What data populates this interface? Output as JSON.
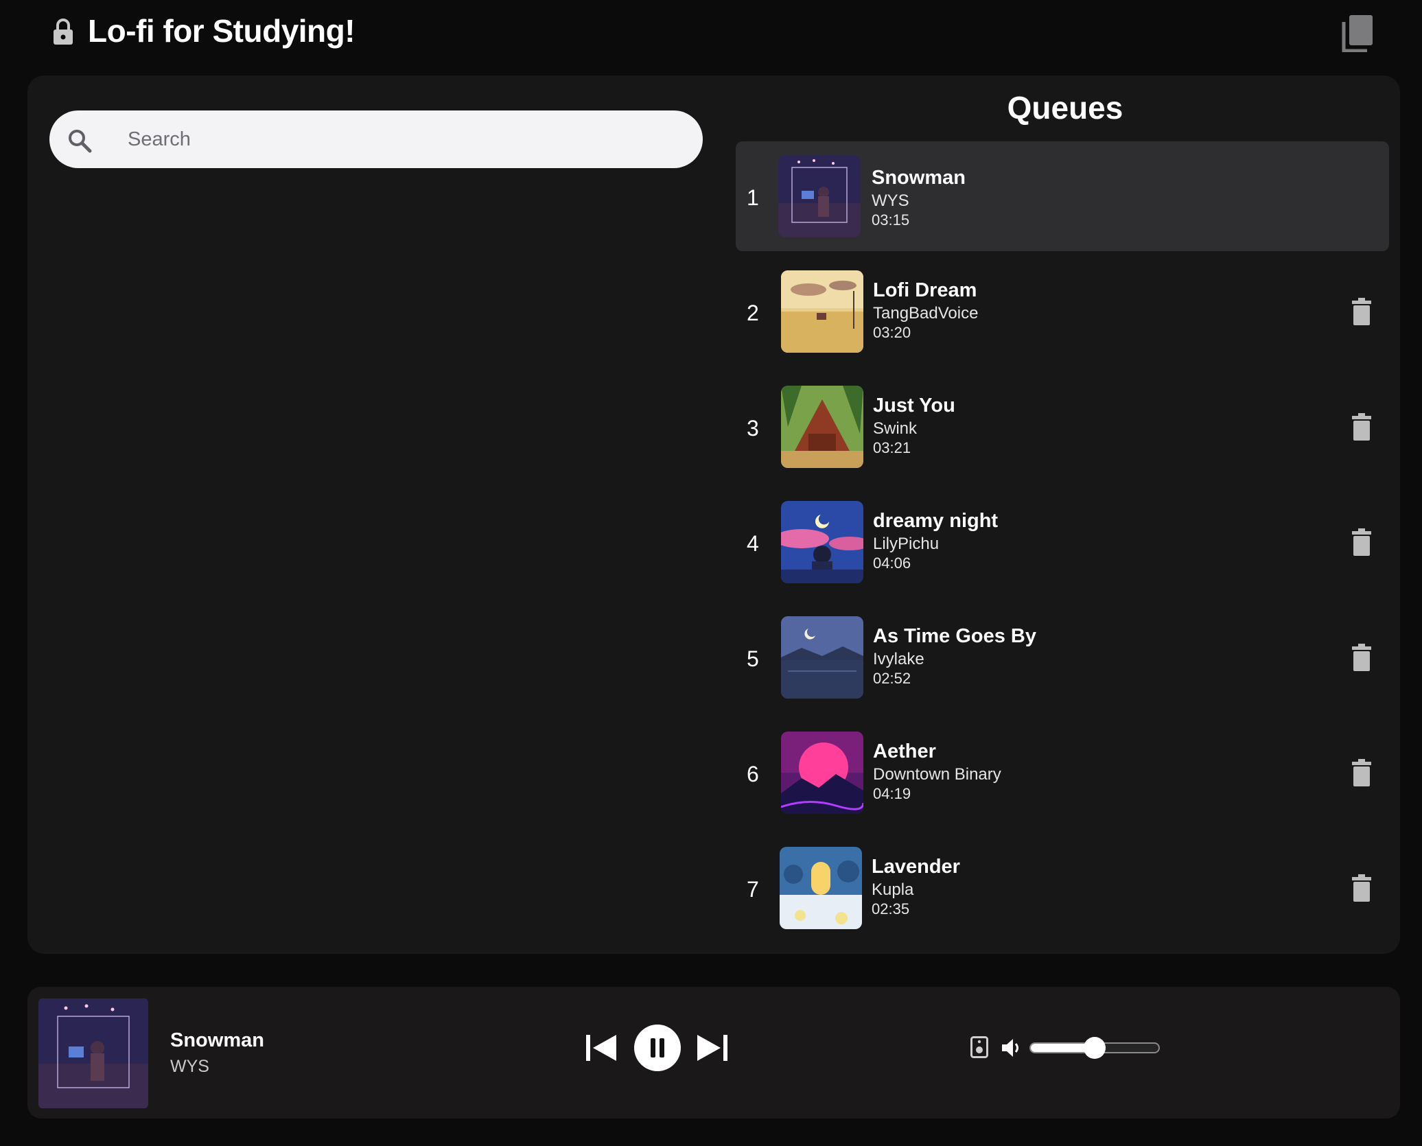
{
  "header": {
    "title": "Lo-fi for Studying!"
  },
  "search": {
    "placeholder": "Search"
  },
  "queue": {
    "heading": "Queues",
    "items": [
      {
        "num": "1",
        "title": "Snowman",
        "artist": "WYS",
        "duration": "03:15",
        "active": true
      },
      {
        "num": "2",
        "title": "Lofi Dream",
        "artist": "TangBadVoice",
        "duration": "03:20",
        "active": false
      },
      {
        "num": "3",
        "title": "Just You",
        "artist": "Swink",
        "duration": "03:21",
        "active": false
      },
      {
        "num": "4",
        "title": "dreamy night",
        "artist": "LilyPichu",
        "duration": "04:06",
        "active": false
      },
      {
        "num": "5",
        "title": "As Time Goes By",
        "artist": "Ivylake",
        "duration": "02:52",
        "active": false
      },
      {
        "num": "6",
        "title": "Aether",
        "artist": "Downtown Binary",
        "duration": "04:19",
        "active": false
      },
      {
        "num": "7",
        "title": "Lavender",
        "artist": "Kupla",
        "duration": "02:35",
        "active": false
      }
    ]
  },
  "player": {
    "title": "Snowman",
    "artist": "WYS",
    "volume": 0.5
  },
  "icons": {
    "lock": "lock-icon",
    "copy": "copy-icon",
    "search": "search-icon",
    "trash": "trash-icon",
    "prev": "skip-previous-icon",
    "pause": "pause-icon",
    "next": "skip-next-icon",
    "speaker": "speaker-icon",
    "volume": "volume-icon"
  },
  "colors": {
    "background": "#0b0b0c",
    "panel": "#181718",
    "active_row": "#2e2d2f",
    "player_bar": "#1a1818"
  }
}
